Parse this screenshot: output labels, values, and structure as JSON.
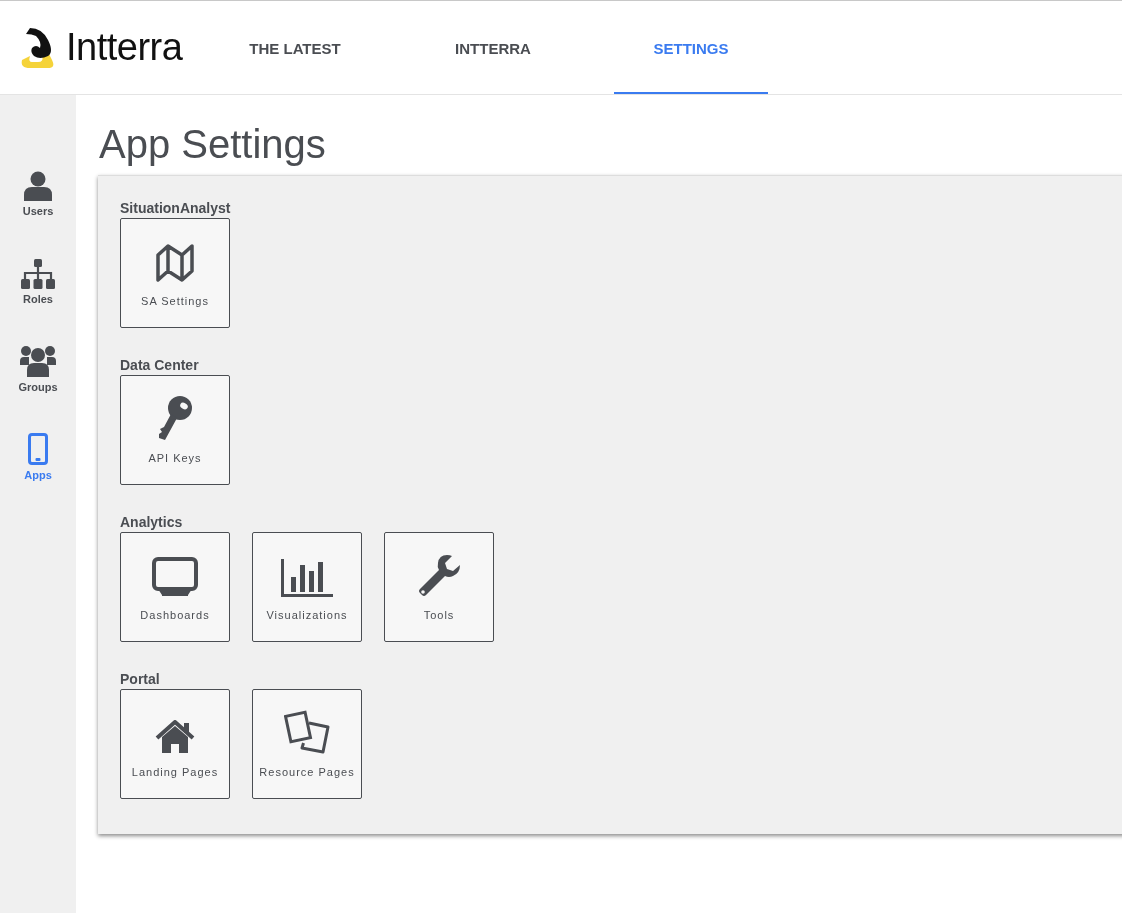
{
  "logo": {
    "text": "Intterra"
  },
  "tabs": [
    {
      "label": "THE LATEST",
      "selected": false
    },
    {
      "label": "INTTERRA",
      "selected": false
    },
    {
      "label": "SETTINGS",
      "selected": true
    }
  ],
  "sidebar": {
    "items": [
      {
        "kind": "user",
        "label": "Users",
        "selected": false
      },
      {
        "kind": "hierarchy",
        "label": "Roles",
        "selected": false
      },
      {
        "kind": "group",
        "label": "Groups",
        "selected": false
      },
      {
        "kind": "phone",
        "label": "Apps",
        "selected": true
      }
    ]
  },
  "page_title": "App Settings",
  "sections": [
    {
      "title": "SituationAnalyst",
      "tiles": [
        {
          "kind": "map",
          "label": "SA Settings"
        }
      ]
    },
    {
      "title": "Data Center",
      "tiles": [
        {
          "kind": "key",
          "label": "API Keys"
        }
      ]
    },
    {
      "title": "Analytics",
      "tiles": [
        {
          "kind": "monitor",
          "label": "Dashboards"
        },
        {
          "kind": "chart",
          "label": "Visualizations"
        },
        {
          "kind": "wrench",
          "label": "Tools"
        }
      ]
    },
    {
      "title": "Portal",
      "tiles": [
        {
          "kind": "house",
          "label": "Landing Pages"
        },
        {
          "kind": "pages",
          "label": "Resource Pages"
        }
      ]
    }
  ]
}
